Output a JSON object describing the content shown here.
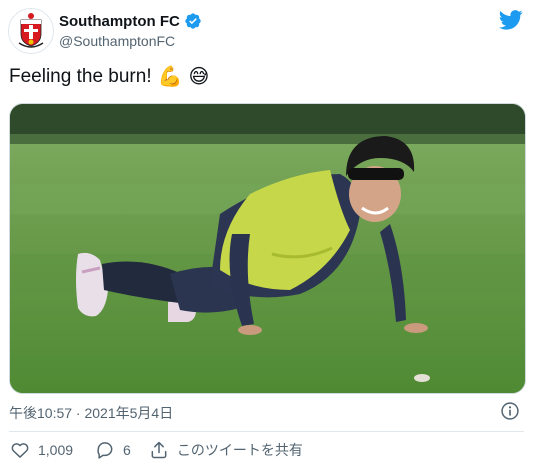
{
  "header": {
    "display_name": "Southampton FC",
    "handle": "@SouthamptonFC",
    "verified": true,
    "avatar_icon": "southampton-crest",
    "logo_icon": "twitter-bird-icon"
  },
  "tweet": {
    "text": "Feeling the burn!",
    "emojis": [
      "💪",
      "😅"
    ],
    "photo_description_icon": "player-pushup-photo"
  },
  "footer": {
    "timestamp": "午後10:57 · 2021年5月4日",
    "like_count": "1,009",
    "reply_count": "6",
    "share_label": "このツイートを共有"
  },
  "colors": {
    "twitter_blue": "#1d9bf0",
    "text_primary": "#0f1419",
    "text_secondary": "#536471",
    "divider": "#e1e8ed"
  }
}
